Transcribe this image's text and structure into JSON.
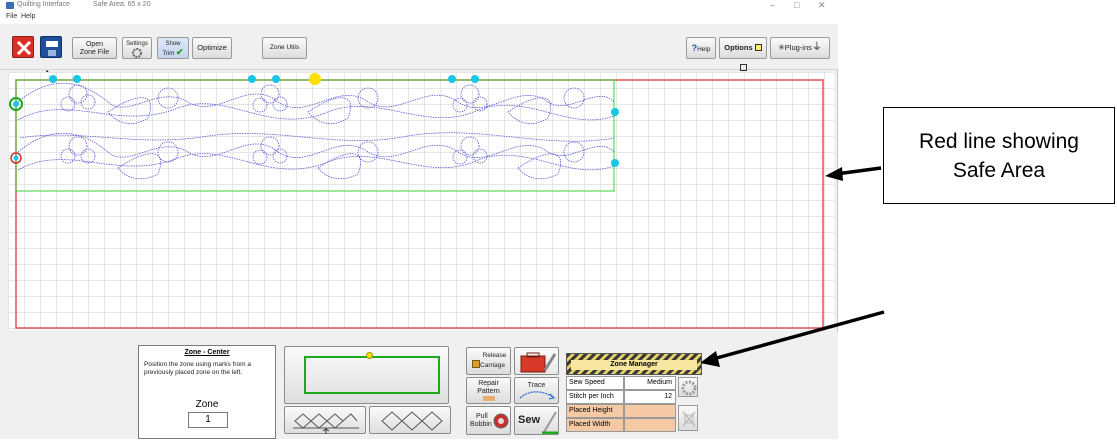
{
  "window": {
    "title": "Quilting Interface",
    "safe_area": "Safe Area: 65 x 20",
    "controls": [
      "–",
      "□",
      "✕"
    ]
  },
  "menu": [
    "File",
    "Help"
  ],
  "toolbar": {
    "open_zone_file": [
      "Open",
      "Zone File"
    ],
    "settings": "Settings",
    "show_trim": [
      "Show",
      "Trim"
    ],
    "optimize": "Optimize",
    "zone_utils": "Zone Utils",
    "help": "Help",
    "options": "Options",
    "plugins": "Plug-ins"
  },
  "zone_panel": {
    "title": "Zone - Center",
    "description": "Position the zone using marks from a previously placed zone on the left.",
    "zone_label": "Zone",
    "zone_value": "1"
  },
  "actions": {
    "release_carriage": [
      "Release",
      "Carriage"
    ],
    "repair_pattern": [
      "Repair",
      "Pattern"
    ],
    "trace": "Trace",
    "pull_bobbin": [
      "Pull",
      "Bobbin"
    ],
    "sew": "Sew"
  },
  "zone_manager": {
    "title": "Zone Manager",
    "rows": [
      {
        "label": "Sew Speed",
        "value": "Medium"
      },
      {
        "label": "Stitch per Inch",
        "value": "12"
      },
      {
        "label": "Placed Height",
        "value": ""
      },
      {
        "label": "Placed Width",
        "value": ""
      }
    ]
  },
  "callout": {
    "line1": "Red line showing",
    "line2": "Safe Area"
  },
  "colors": {
    "safe_area_line": "#e05252",
    "zone_border": "#3ad13a",
    "stitch_pattern": "#5a5ad6",
    "marker_cyan": "#16c6e6",
    "marker_yellow": "#ffe000"
  }
}
